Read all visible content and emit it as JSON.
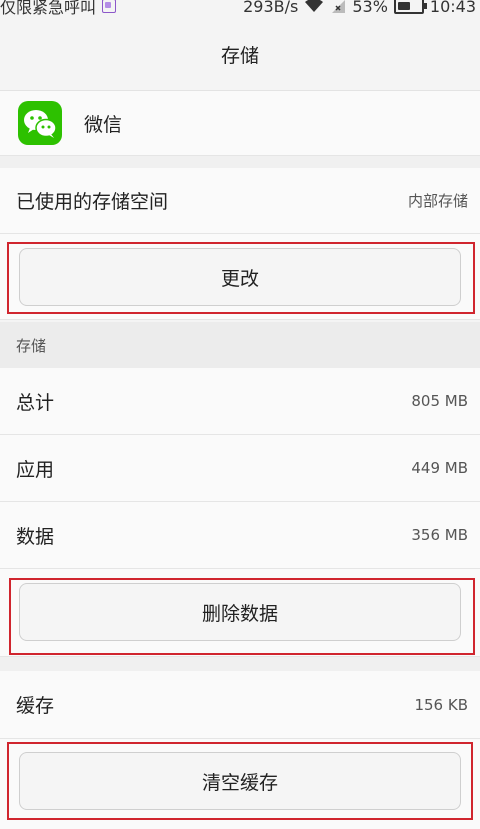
{
  "status_bar": {
    "carrier_text": "仅限紧急呼叫",
    "speed": "293B/s",
    "battery_percent": "53%",
    "battery_level": 0.53,
    "time": "10:43"
  },
  "header": {
    "title": "存储"
  },
  "app": {
    "name": "微信",
    "icon": "wechat-icon",
    "icon_color": "#2dc100"
  },
  "storage_location": {
    "label": "已使用的存储空间",
    "value": "内部存储",
    "change_button": "更改"
  },
  "storage_section": {
    "header": "存储",
    "rows": [
      {
        "label": "总计",
        "value": "805 MB"
      },
      {
        "label": "应用",
        "value": "449 MB"
      },
      {
        "label": "数据",
        "value": "356 MB"
      }
    ],
    "clear_data_button": "删除数据"
  },
  "cache": {
    "label": "缓存",
    "value": "156 KB",
    "clear_cache_button": "清空缓存"
  },
  "highlight_color": "#d0252e"
}
